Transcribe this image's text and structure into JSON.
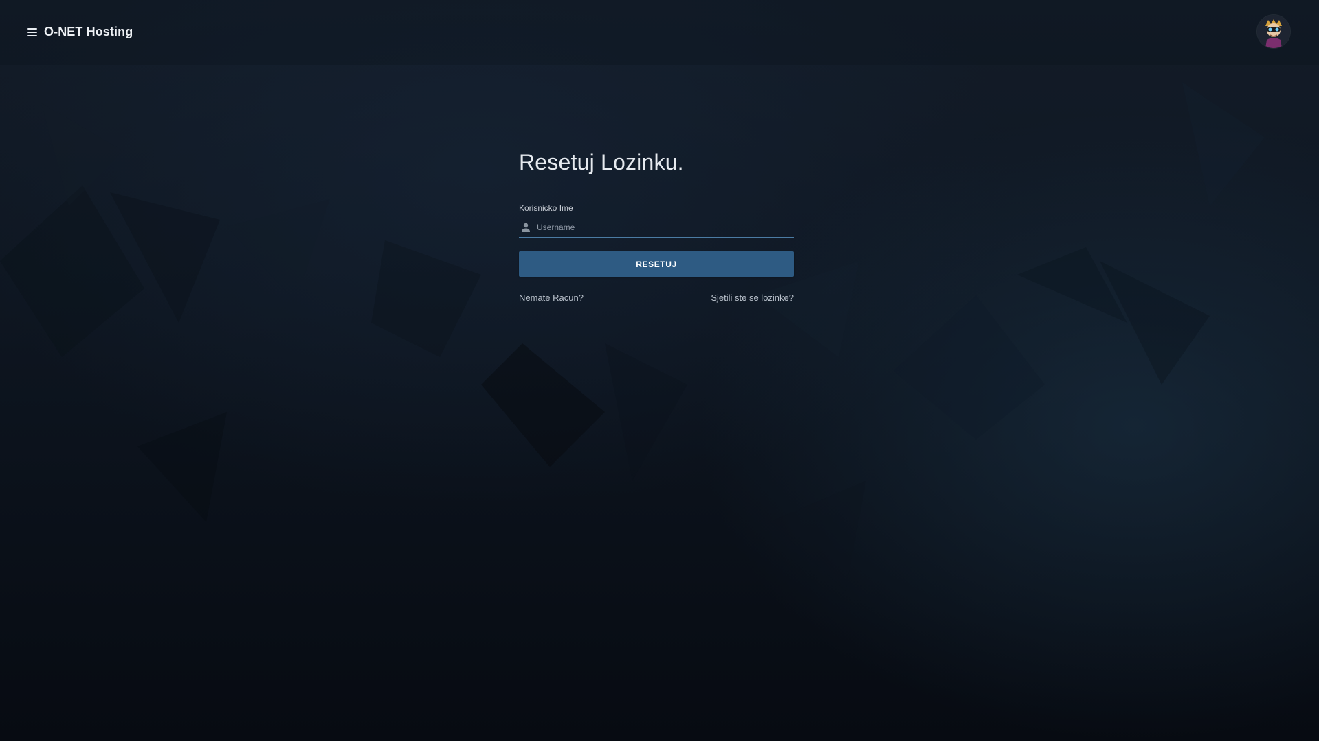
{
  "header": {
    "brand_name": "O-NET Hosting",
    "menu_icon": "hamburger-menu-icon",
    "avatar_icon": "user-avatar"
  },
  "form": {
    "title": "Resetuj Lozinku.",
    "username_label": "Korisnicko Ime",
    "username_placeholder": "Username",
    "username_value": "",
    "username_icon": "user-icon",
    "submit_label": "RESETUJ",
    "register_link": "Nemate Racun?",
    "login_link": "Sjetili ste se lozinke?"
  },
  "colors": {
    "background": "#0e1621",
    "accent": "#2e5b83",
    "input_underline": "#4b7ba3",
    "text": "#e6eaef"
  }
}
